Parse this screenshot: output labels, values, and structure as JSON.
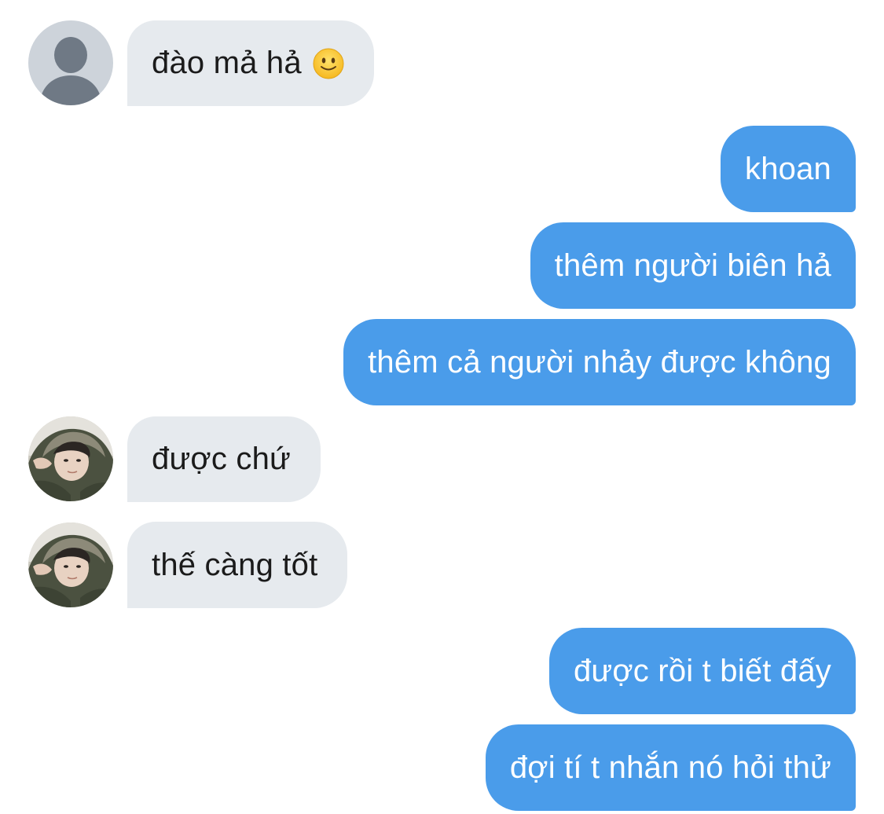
{
  "conversation": {
    "messages": [
      {
        "sender": "other",
        "avatar": "default-avatar-icon",
        "text": "đào mả hả",
        "emoji": "slightly-smiling-face"
      },
      {
        "sender": "me",
        "text": "khoan"
      },
      {
        "sender": "me",
        "text": "thêm người biên hả"
      },
      {
        "sender": "me",
        "text": "thêm cả người nhảy được không"
      },
      {
        "sender": "other",
        "avatar": "user-photo-avatar",
        "text": "được chứ"
      },
      {
        "sender": "other",
        "avatar": "user-photo-avatar",
        "text": "thế càng tốt"
      },
      {
        "sender": "me",
        "text": "được rồi t biết đấy"
      },
      {
        "sender": "me",
        "text": "đợi tí t nhắn nó hỏi thử"
      }
    ]
  },
  "colors": {
    "incoming_bubble": "#e6eaee",
    "outgoing_bubble": "#4a9cea",
    "incoming_text": "#1b1b1b",
    "outgoing_text": "#ffffff",
    "default_avatar_bg": "#cdd3da",
    "default_avatar_fg": "#6f7985"
  }
}
